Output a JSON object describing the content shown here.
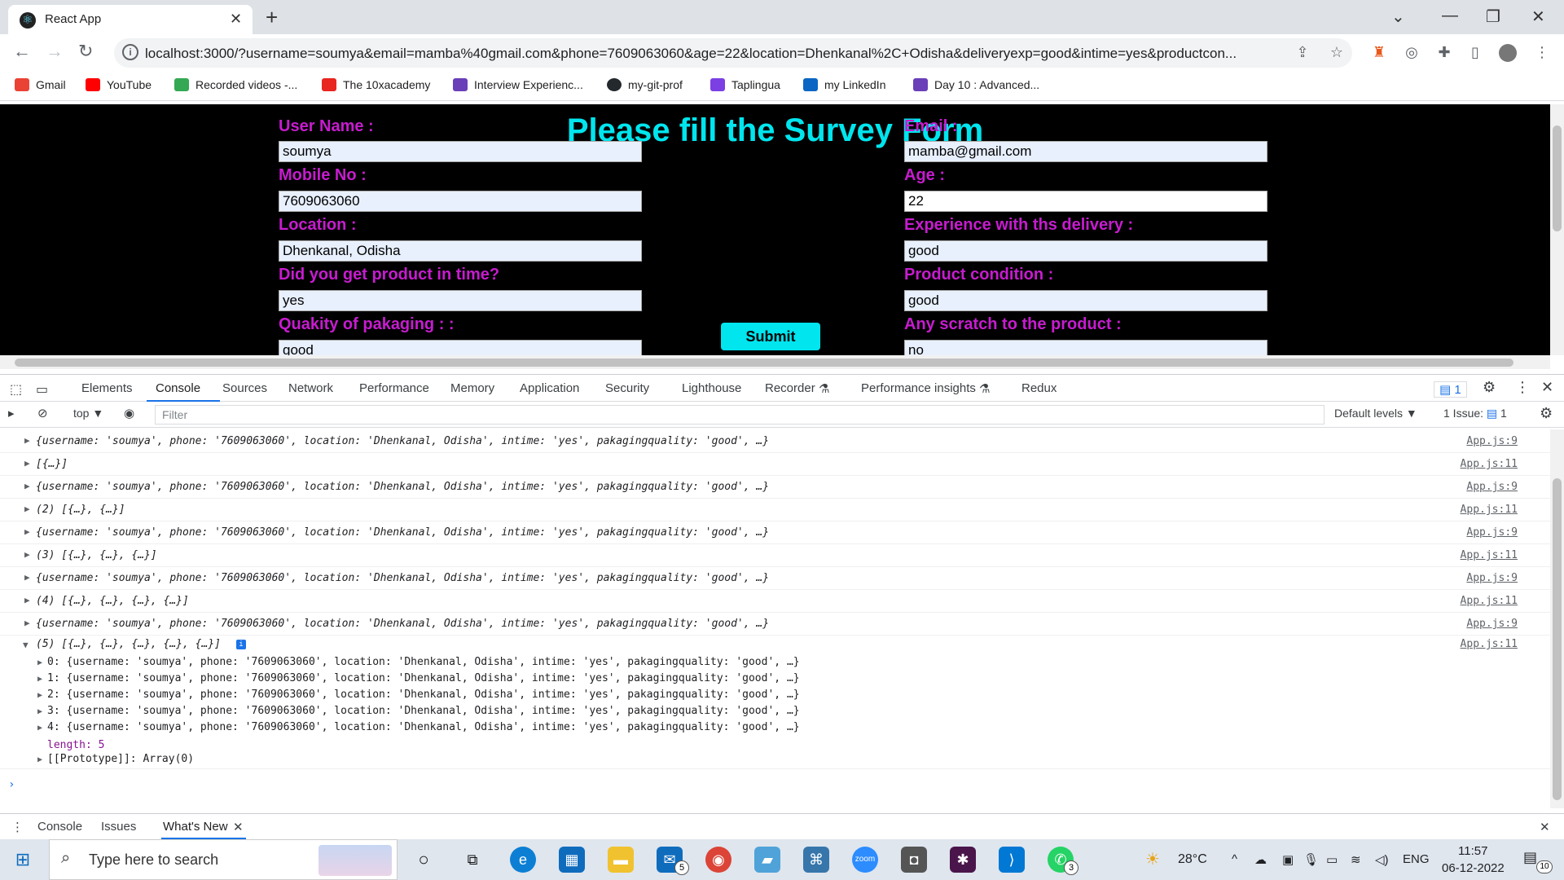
{
  "browser": {
    "tab_title": "React App",
    "url": "localhost:3000/?username=soumya&email=mamba%40gmail.com&phone=7609063060&age=22&location=Dhenkanal%2C+Odisha&deliveryexp=good&intime=yes&productcon..."
  },
  "bookmarks": [
    "Gmail",
    "YouTube",
    "Recorded videos -...",
    "The 10xacademy",
    "Interview Experienc...",
    "my-git-prof",
    "Taplingua",
    "my LinkedIn",
    "Day 10 : Advanced..."
  ],
  "form": {
    "title": "Please fill the Survey Form",
    "username_label": "User Name :",
    "username_value": "soumya",
    "email_label": "Email :",
    "email_value": "mamba@gmail.com",
    "phone_label": "Mobile No :",
    "phone_value": "7609063060",
    "age_label": "Age :",
    "age_value": "22",
    "location_label": "Location :",
    "location_value": "Dhenkanal, Odisha",
    "deliveryexp_label": "Experience with ths delivery :",
    "deliveryexp_value": "good",
    "intime_label": "Did you get product in time?",
    "intime_value": "yes",
    "productcond_label": "Product condition :",
    "productcond_value": "good",
    "packaging_label": "Quakity of pakaging : :",
    "packaging_value": "good",
    "scratch_label": "Any scratch to the product :",
    "scratch_value": "no",
    "submit_label": "Submit"
  },
  "devtools": {
    "tabs": [
      "Elements",
      "Console",
      "Sources",
      "Network",
      "Performance",
      "Memory",
      "Application",
      "Security",
      "Lighthouse",
      "Recorder",
      "Performance insights",
      "Redux"
    ],
    "issues_badge": "1",
    "context": "top",
    "filter_placeholder": "Filter",
    "levels": "Default levels",
    "issues_label": "1 Issue:",
    "issues_count": "1"
  },
  "console": {
    "obj_line": "{username: 'soumya', phone: '7609063060', location: 'Dhenkanal, Odisha', intime: 'yes', pakagingquality: 'good', …}",
    "rows": [
      {
        "text": "{username: 'soumya', phone: '7609063060', location: 'Dhenkanal, Odisha', intime: 'yes', pakagingquality: 'good', …}",
        "src": "App.js:9"
      },
      {
        "text": "[{…}]",
        "src": "App.js:11"
      },
      {
        "text": "{username: 'soumya', phone: '7609063060', location: 'Dhenkanal, Odisha', intime: 'yes', pakagingquality: 'good', …}",
        "src": "App.js:9"
      },
      {
        "text": "(2) [{…}, {…}]",
        "src": "App.js:11"
      },
      {
        "text": "{username: 'soumya', phone: '7609063060', location: 'Dhenkanal, Odisha', intime: 'yes', pakagingquality: 'good', …}",
        "src": "App.js:9"
      },
      {
        "text": "(3) [{…}, {…}, {…}]",
        "src": "App.js:11"
      },
      {
        "text": "{username: 'soumya', phone: '7609063060', location: 'Dhenkanal, Odisha', intime: 'yes', pakagingquality: 'good', …}",
        "src": "App.js:9"
      },
      {
        "text": "(4) [{…}, {…}, {…}, {…}]",
        "src": "App.js:11"
      },
      {
        "text": "{username: 'soumya', phone: '7609063060', location: 'Dhenkanal, Odisha', intime: 'yes', pakagingquality: 'good', …}",
        "src": "App.js:9"
      }
    ],
    "expanded_header": "(5) [{…}, {…}, {…}, {…}, {…}]",
    "expanded_src": "App.js:11",
    "expanded_items": [
      "0: {username: 'soumya', phone: '7609063060', location: 'Dhenkanal, Odisha', intime: 'yes', pakagingquality: 'good', …}",
      "1: {username: 'soumya', phone: '7609063060', location: 'Dhenkanal, Odisha', intime: 'yes', pakagingquality: 'good', …}",
      "2: {username: 'soumya', phone: '7609063060', location: 'Dhenkanal, Odisha', intime: 'yes', pakagingquality: 'good', …}",
      "3: {username: 'soumya', phone: '7609063060', location: 'Dhenkanal, Odisha', intime: 'yes', pakagingquality: 'good', …}",
      "4: {username: 'soumya', phone: '7609063060', location: 'Dhenkanal, Odisha', intime: 'yes', pakagingquality: 'good', …}"
    ],
    "length_line": "length: 5",
    "prototype_line": "[[Prototype]]: Array(0)"
  },
  "drawer": {
    "tabs": [
      "Console",
      "Issues",
      "What's New"
    ]
  },
  "taskbar": {
    "search_placeholder": "Type here to search",
    "weather": "28°C",
    "lang": "ENG",
    "time": "11:57",
    "date": "06-12-2022",
    "mail_badge": "5",
    "whatsapp_badge": "3",
    "notif_badge": "10"
  },
  "colors": {
    "form_bg": "#000000",
    "title": "#00e5ee",
    "label": "#c71ccf",
    "accent": "#1a73e8"
  }
}
